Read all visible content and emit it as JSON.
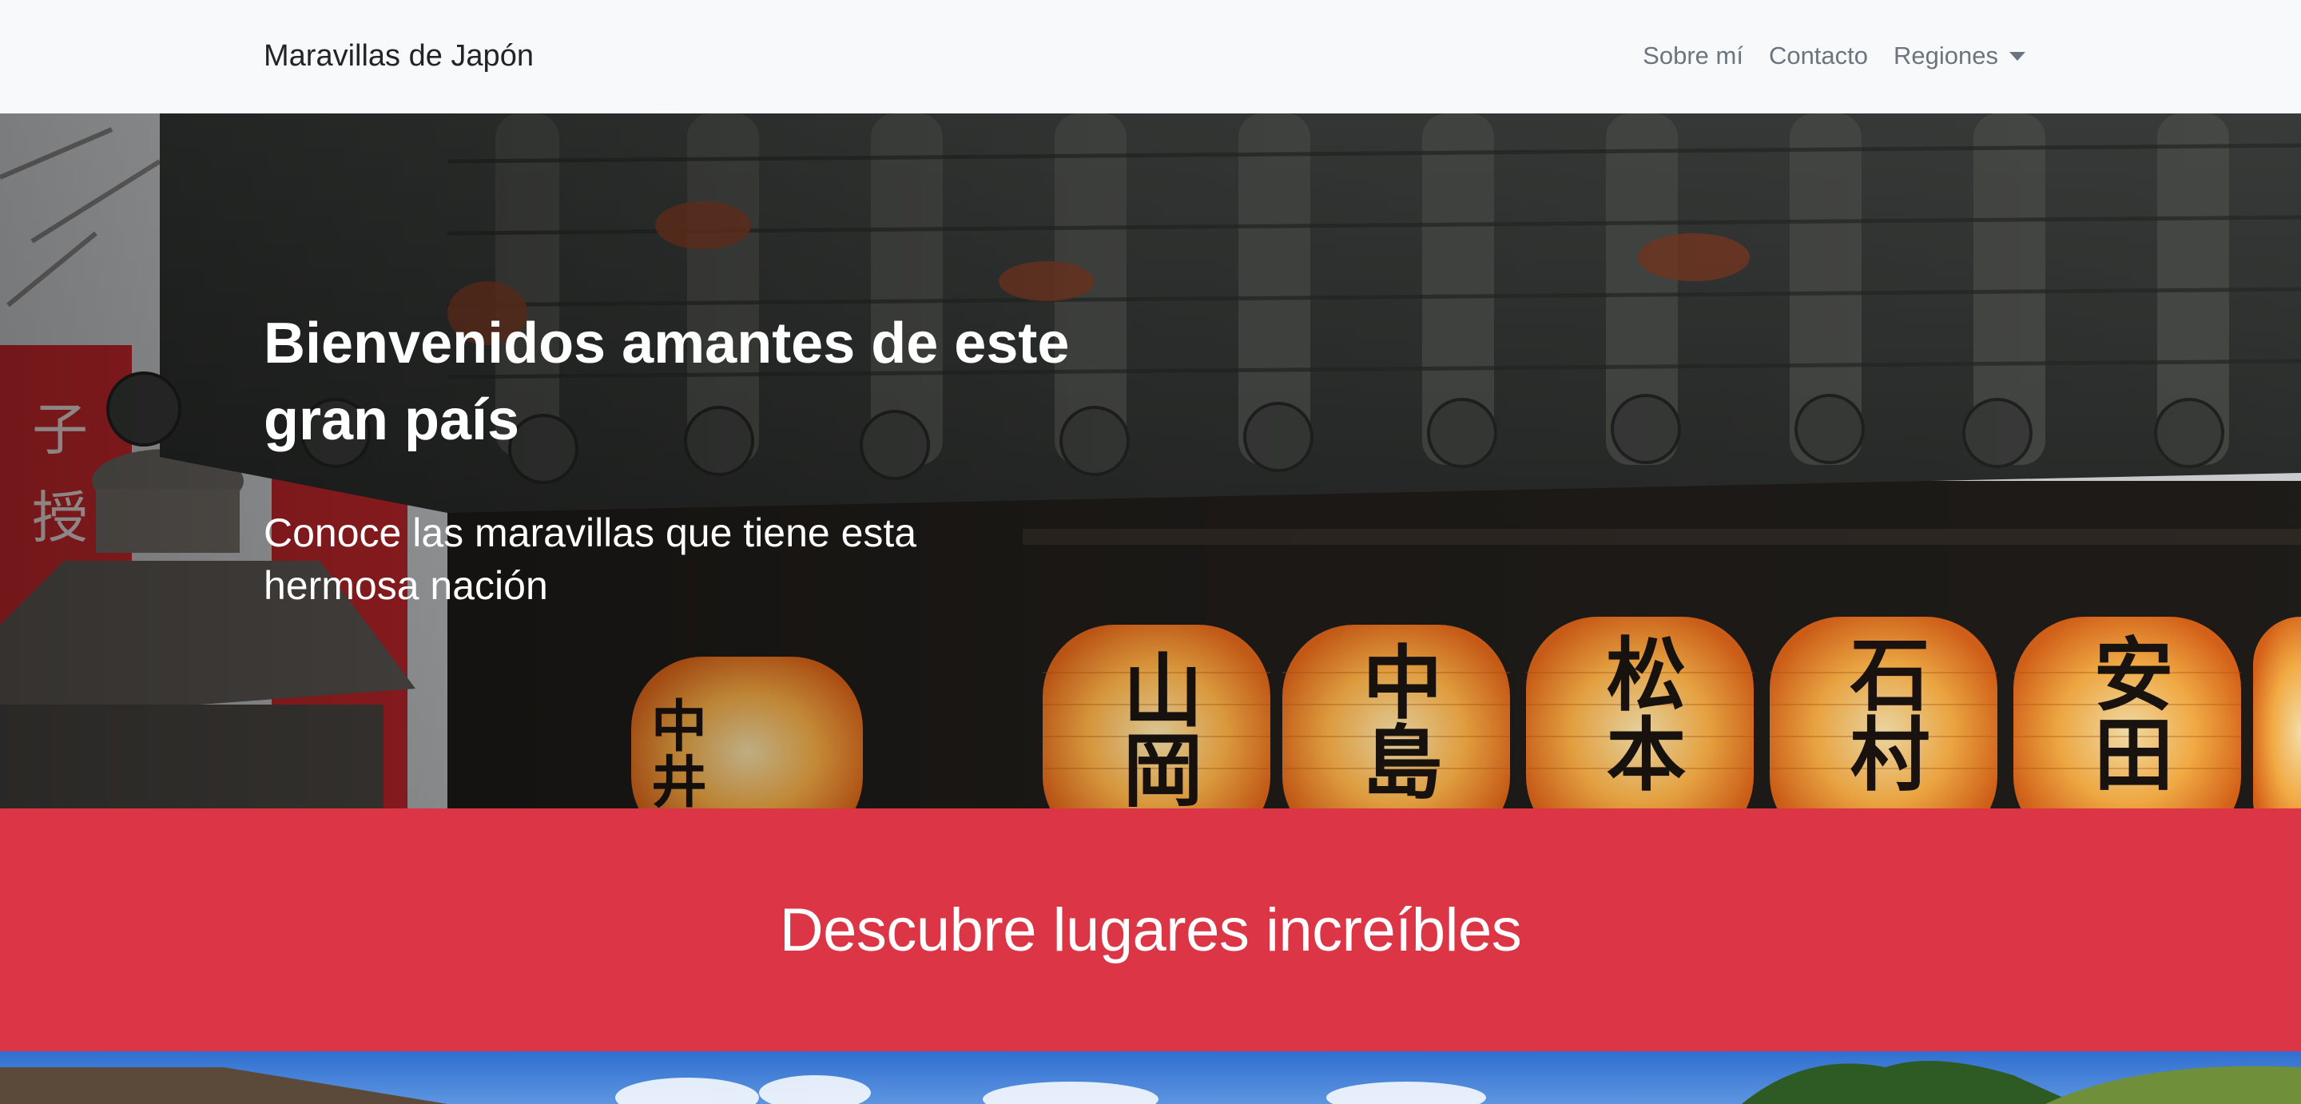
{
  "navbar": {
    "brand": "Maravillas de Japón",
    "items": [
      {
        "label": "Sobre mí"
      },
      {
        "label": "Contacto"
      },
      {
        "label": "Regiones"
      }
    ]
  },
  "hero": {
    "title": "Bienvenidos amantes de este gran país",
    "subtitle": "Conoce las maravillas que tiene esta hermosa nación",
    "lantern_characters": [
      "中井",
      "山岡",
      "中島",
      "松本",
      "石村",
      "安田"
    ]
  },
  "banner": {
    "title": "Descubre lugares increíbles"
  },
  "colors": {
    "navbar_bg": "#f8f9fa",
    "banner_red": "#dc3545",
    "nav_link": "#6c757d",
    "brand_text": "#212529"
  }
}
